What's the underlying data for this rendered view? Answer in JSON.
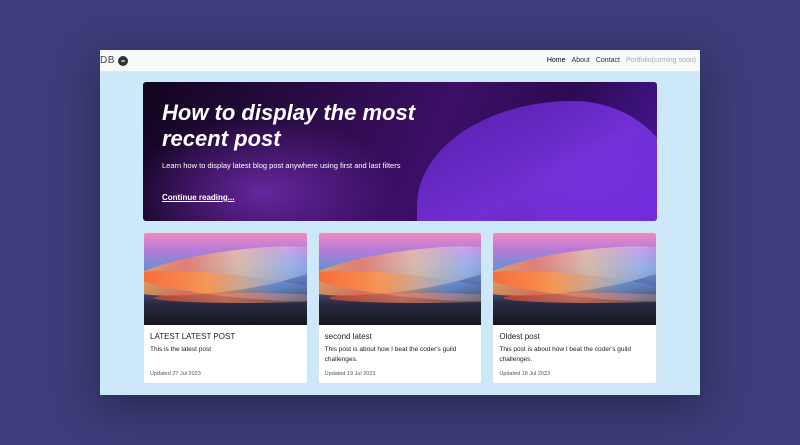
{
  "navbar": {
    "brand": "DB",
    "links": [
      {
        "label": "Home",
        "state": "active"
      },
      {
        "label": "About",
        "state": "normal"
      },
      {
        "label": "Contact",
        "state": "normal"
      },
      {
        "label": "Portfolio(coming soon)",
        "state": "disabled"
      }
    ]
  },
  "hero": {
    "title": "How to display the most recent post",
    "description": "Learn how to display latest blog post anywhere using first and last filters",
    "link": "Continue reading..."
  },
  "cards": [
    {
      "title": "LATEST LATEST POST",
      "text": "This is the latest post",
      "date": "Updated 27 Jul 2023"
    },
    {
      "title": "second latest",
      "text": "This post is about how I beat the coder's guild challenges.",
      "date": "Updated 19 Jul 2023"
    },
    {
      "title": "Oldest post",
      "text": "This post is about how I beat the coder's guild challenges.",
      "date": "Updated 18 Jul 2023"
    }
  ],
  "colors": {
    "page_background": "#3c3d7a",
    "content_background": "#cde8f8",
    "hero_accent": "#7b2ff0"
  }
}
